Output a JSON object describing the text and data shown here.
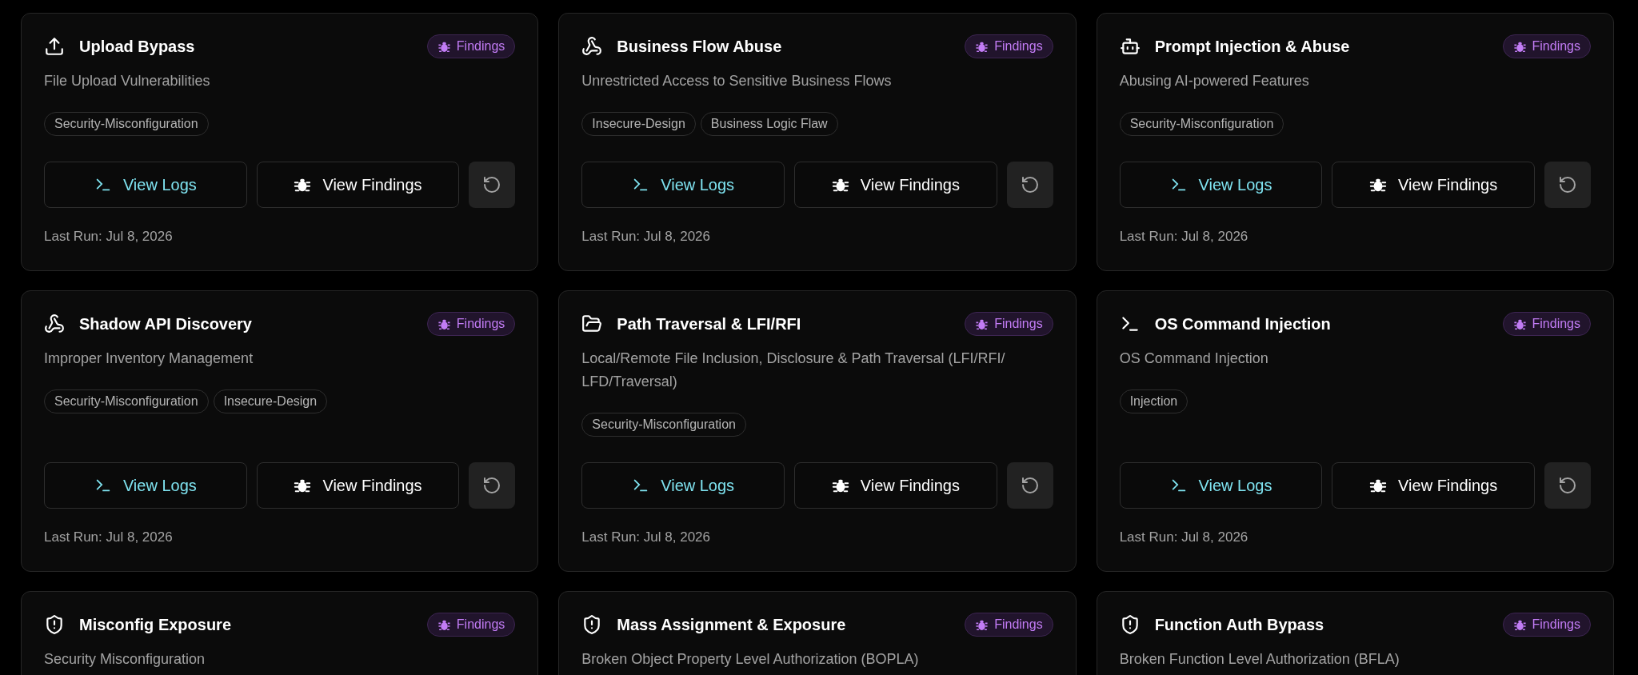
{
  "cards": [
    {
      "kind": "upload",
      "title": "Upload Bypass",
      "badge": "Findings",
      "subtitle": "File Upload Vulnerabilities",
      "tags": [
        "Security-Misconfiguration"
      ],
      "logs_button": "View Logs",
      "findings_button": "View Findings",
      "last_run": "Last Run: Jul 8, 2026"
    },
    {
      "kind": "webhook",
      "title": "Business Flow Abuse",
      "badge": "Findings",
      "subtitle": "Unrestricted Access to Sensitive Business Flows",
      "tags": [
        "Insecure-Design",
        "Business Logic Flaw"
      ],
      "logs_button": "View Logs",
      "findings_button": "View Findings",
      "last_run": "Last Run: Jul 8, 2026"
    },
    {
      "kind": "bot",
      "title": "Prompt Injection & Abuse",
      "badge": "Findings",
      "subtitle": "Abusing AI-powered Features",
      "tags": [
        "Security-Misconfiguration"
      ],
      "logs_button": "View Logs",
      "findings_button": "View Findings",
      "last_run": "Last Run: Jul 8, 2026"
    },
    {
      "kind": "webhook",
      "title": "Shadow API Discovery",
      "badge": "Findings",
      "subtitle": "Improper Inventory Management",
      "tags": [
        "Security-Misconfiguration",
        "Insecure-Design"
      ],
      "logs_button": "View Logs",
      "findings_button": "View Findings",
      "last_run": "Last Run: Jul 8, 2026"
    },
    {
      "kind": "folder",
      "title": "Path Traversal & LFI/RFI",
      "badge": "Findings",
      "subtitle": "Local/Remote File Inclusion, Disclosure & Path Traversal (LFI/RFI/ LFD/Traversal)",
      "tags": [
        "Security-Misconfiguration"
      ],
      "logs_button": "View Logs",
      "findings_button": "View Findings",
      "last_run": "Last Run: Jul 8, 2026"
    },
    {
      "kind": "terminal",
      "title": "OS Command Injection",
      "badge": "Findings",
      "subtitle": "OS Command Injection",
      "tags": [
        "Injection"
      ],
      "logs_button": "View Logs",
      "findings_button": "View Findings",
      "last_run": "Last Run: Jul 8, 2026"
    },
    {
      "kind": "shield",
      "title": "Misconfig Exposure",
      "badge": "Findings",
      "subtitle": "Security Misconfiguration"
    },
    {
      "kind": "shield",
      "title": "Mass Assignment & Exposure",
      "badge": "Findings",
      "subtitle": "Broken Object Property Level Authorization (BOPLA)"
    },
    {
      "kind": "shield",
      "title": "Function Auth Bypass",
      "badge": "Findings",
      "subtitle": "Broken Function Level Authorization (BFLA)"
    }
  ]
}
